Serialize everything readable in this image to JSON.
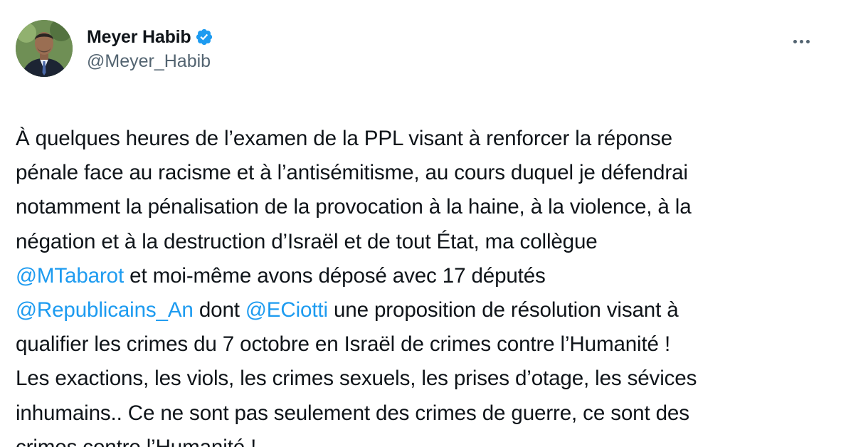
{
  "author": {
    "display_name": "Meyer Habib",
    "handle": "@Meyer_Habib",
    "verified_icon": "verified-badge-icon",
    "accent": "#1d9bf0"
  },
  "menu": {
    "icon": "more-horizontal-icon"
  },
  "tweet": {
    "lines": [
      [
        {
          "t": "À quelques heures de l’examen de la PPL visant à renforcer la réponse"
        }
      ],
      [
        {
          "t": "pénale face au racisme et à l’antisémitisme, au cours duquel je défendrai"
        }
      ],
      [
        {
          "t": "notamment la pénalisation de la provocation à la haine, à la violence, à la"
        }
      ],
      [
        {
          "t": "négation et à la destruction d’Israël et de tout État, ma collègue"
        }
      ],
      [
        {
          "m": "@MTabarot"
        },
        {
          "t": " et moi-même avons déposé avec 17 députés"
        }
      ],
      [
        {
          "m": "@Republicains_An"
        },
        {
          "t": " dont "
        },
        {
          "m": "@ECiotti"
        },
        {
          "t": " une proposition de résolution visant à"
        }
      ],
      [
        {
          "t": "qualifier les crimes du 7 octobre en Israël de crimes contre l’Humanité !"
        }
      ],
      [
        {
          "t": "Les exactions, les viols, les crimes sexuels, les prises d’otage, les sévices"
        }
      ],
      [
        {
          "t": "inhumains.. Ce ne sont pas seulement des crimes de guerre, ce sont des"
        }
      ],
      [
        {
          "t": "crimes contre l’Humanité !"
        }
      ]
    ]
  }
}
